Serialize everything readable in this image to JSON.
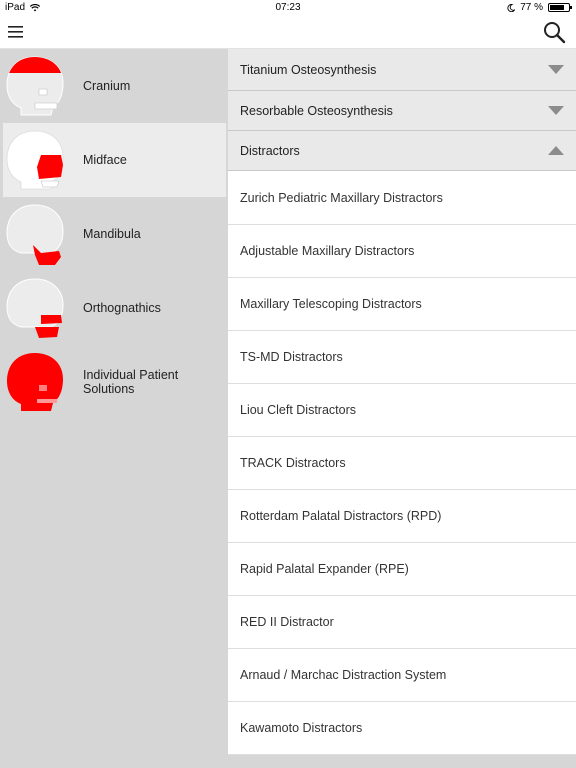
{
  "status_bar": {
    "device": "iPad",
    "time": "07:23",
    "battery": "77 %",
    "battery_level": 0.77
  },
  "nav": {
    "menu_icon": "hamburger-menu-icon",
    "search_icon": "search-icon"
  },
  "sidebar": {
    "items": [
      {
        "label": "Cranium",
        "icon": "skull-cranium-icon",
        "highlight": "cranium"
      },
      {
        "label": "Midface",
        "icon": "skull-midface-icon",
        "highlight": "midface",
        "selected": true
      },
      {
        "label": "Mandibula",
        "icon": "skull-mandibula-icon",
        "highlight": "mandibula"
      },
      {
        "label": "Orthognathics",
        "icon": "skull-orthognathics-icon",
        "highlight": "orthognathics"
      },
      {
        "label": "Individual Patient Solutions",
        "icon": "skull-individual-icon",
        "highlight": "full"
      }
    ]
  },
  "content": {
    "sections": [
      {
        "title": "Titanium Osteosynthesis",
        "expanded": false
      },
      {
        "title": "Resorbable Osteosynthesis",
        "expanded": false
      },
      {
        "title": "Distractors",
        "expanded": true
      }
    ],
    "items": [
      "Zurich Pediatric Maxillary Distractors",
      "Adjustable Maxillary Distractors",
      "Maxillary Telescoping Distractors",
      "TS-MD Distractors",
      "Liou Cleft Distractors",
      "TRACK Distractors",
      "Rotterdam Palatal Distractors (RPD)",
      "Rapid Palatal Expander (RPE)",
      "RED II Distractor",
      "Arnaud / Marchac Distraction System",
      "Kawamoto Distractors"
    ]
  },
  "colors": {
    "accent_red": "#ff0000",
    "sidebar_bg": "#d6d6d6",
    "selected_bg": "#ececec",
    "section_bg": "#e9e9e9",
    "chevron": "#8c8c8c"
  }
}
